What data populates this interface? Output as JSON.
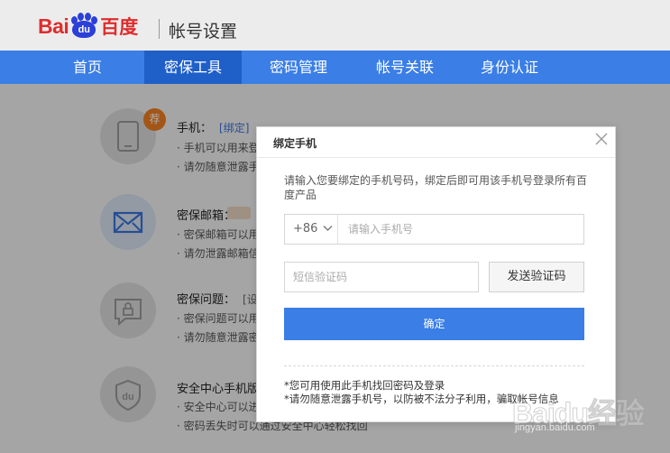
{
  "header": {
    "logo_bai": "Bai",
    "logo_du": "du",
    "logo_cn": "百度",
    "title": "帐号设置"
  },
  "nav": {
    "items": [
      {
        "label": "首页",
        "active": false
      },
      {
        "label": "密保工具",
        "active": true
      },
      {
        "label": "密码管理",
        "active": false
      },
      {
        "label": "帐号关联",
        "active": false
      },
      {
        "label": "身份认证",
        "active": false
      }
    ]
  },
  "security_items": [
    {
      "icon": "phone-icon",
      "badge": "荐",
      "title": "手机：",
      "link": "[绑定]",
      "lines": [
        "· 手机可以用来登",
        "· 请勿随意泄露手"
      ]
    },
    {
      "icon": "mail-icon",
      "title": "密保邮箱：",
      "lines": [
        "· 密保邮箱可以用",
        "· 请勿泄露邮箱信"
      ]
    },
    {
      "icon": "lock-chat-icon",
      "title": "密保问题：",
      "link": "[设",
      "lines": [
        "· 密保问题可以用",
        "· 请勿随意泄露密"
      ]
    },
    {
      "icon": "shield-du-icon",
      "title": "安全中心手机版",
      "lines": [
        "· 安全中心可以进",
        "· 密码丢失时可以通过安全中心轻松找回"
      ]
    }
  ],
  "dialog": {
    "title": "绑定手机",
    "description": "请输入您要绑定的手机号码，绑定后即可用该手机号登录所有百度产品",
    "country_code": "+86",
    "phone_placeholder": "请输入手机号",
    "sms_placeholder": "短信验证码",
    "send_button": "发送验证码",
    "confirm_button": "确定",
    "notes": [
      "*您可用使用此手机找回密码及登录",
      "*请勿随意泄露手机号，以防被不法分子利用，骗取帐号信息"
    ]
  },
  "watermark": {
    "text": "Baidu经验",
    "url": "jingyan.baidu.com"
  },
  "colors": {
    "brand_blue": "#3a7ee6",
    "nav_active": "#1f5fc8",
    "brand_red": "#de2e2e",
    "badge_orange": "#f07f22",
    "link_blue": "#3a73d9"
  }
}
